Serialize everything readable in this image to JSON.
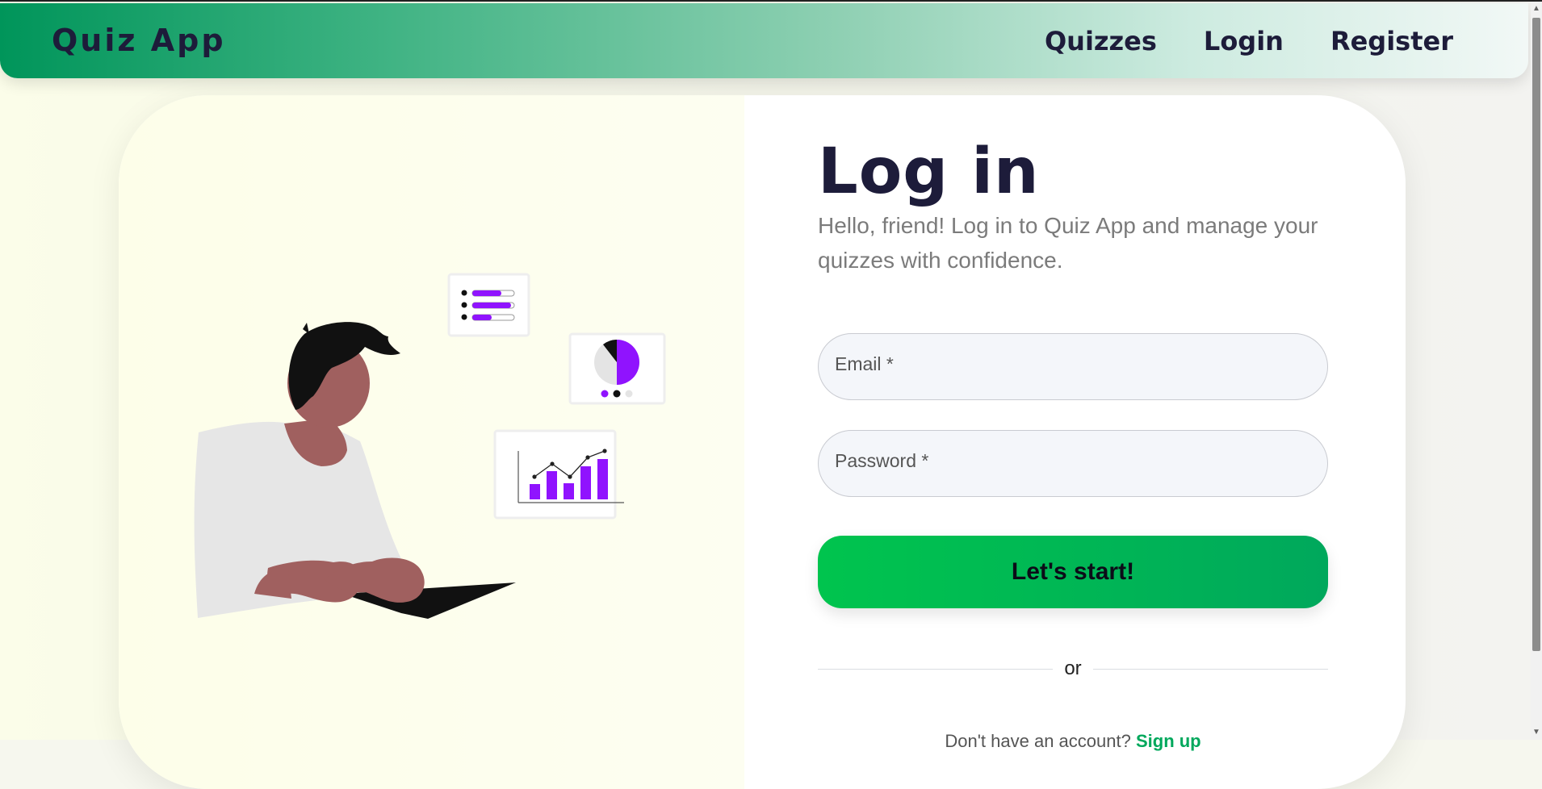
{
  "navbar": {
    "brand": "Quiz App",
    "links": [
      "Quizzes",
      "Login",
      "Register"
    ]
  },
  "login": {
    "title": "Log in",
    "subtitle": "Hello, friend! Log in to Quiz App and manage your quizzes with confidence.",
    "email_label": "Email *",
    "password_label": "Password *",
    "submit_label": "Let's start!",
    "divider_text": "or",
    "register_prompt": "Don't have an account?",
    "register_link": "Sign up"
  },
  "colors": {
    "accent_green": "#00b456",
    "dark_text": "#1d1c3a",
    "chart_purple": "#9013fe"
  },
  "icons": {
    "scroll_up": "scroll-up-arrow-icon",
    "scroll_down": "scroll-down-arrow-icon"
  }
}
